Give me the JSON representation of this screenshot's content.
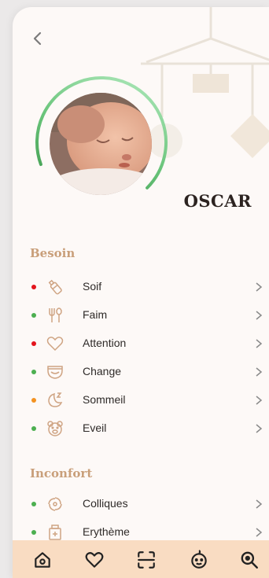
{
  "profile": {
    "name": "OSCAR",
    "progress": 0.68
  },
  "colors": {
    "background": "#fdf9f7",
    "accent": "#c99f7a",
    "ring": "#3f9e4b",
    "dot_green": "#4caf50",
    "dot_red": "#e3141c",
    "dot_orange": "#f39221",
    "tabbar": "#f9dcc2"
  },
  "sections": {
    "besoin": {
      "title": "Besoin",
      "items": [
        {
          "label": "Soif",
          "icon": "bottle-icon",
          "status": "red"
        },
        {
          "label": "Faim",
          "icon": "cutlery-icon",
          "status": "green"
        },
        {
          "label": "Attention",
          "icon": "heart-icon",
          "status": "red"
        },
        {
          "label": "Change",
          "icon": "diaper-icon",
          "status": "green"
        },
        {
          "label": "Sommeil",
          "icon": "moon-sleep-icon",
          "status": "orange"
        },
        {
          "label": "Eveil",
          "icon": "teddy-bear-icon",
          "status": "green"
        }
      ]
    },
    "inconfort": {
      "title": "Inconfort",
      "items": [
        {
          "label": "Colliques",
          "icon": "swirl-icon",
          "status": "green"
        },
        {
          "label": "Erythème",
          "icon": "cream-tube-icon",
          "status": "green"
        }
      ]
    }
  },
  "tabbar": {
    "items": [
      {
        "icon": "home-icon"
      },
      {
        "icon": "heart-icon"
      },
      {
        "icon": "scan-icon"
      },
      {
        "icon": "baby-face-icon"
      },
      {
        "icon": "search-icon"
      }
    ]
  }
}
